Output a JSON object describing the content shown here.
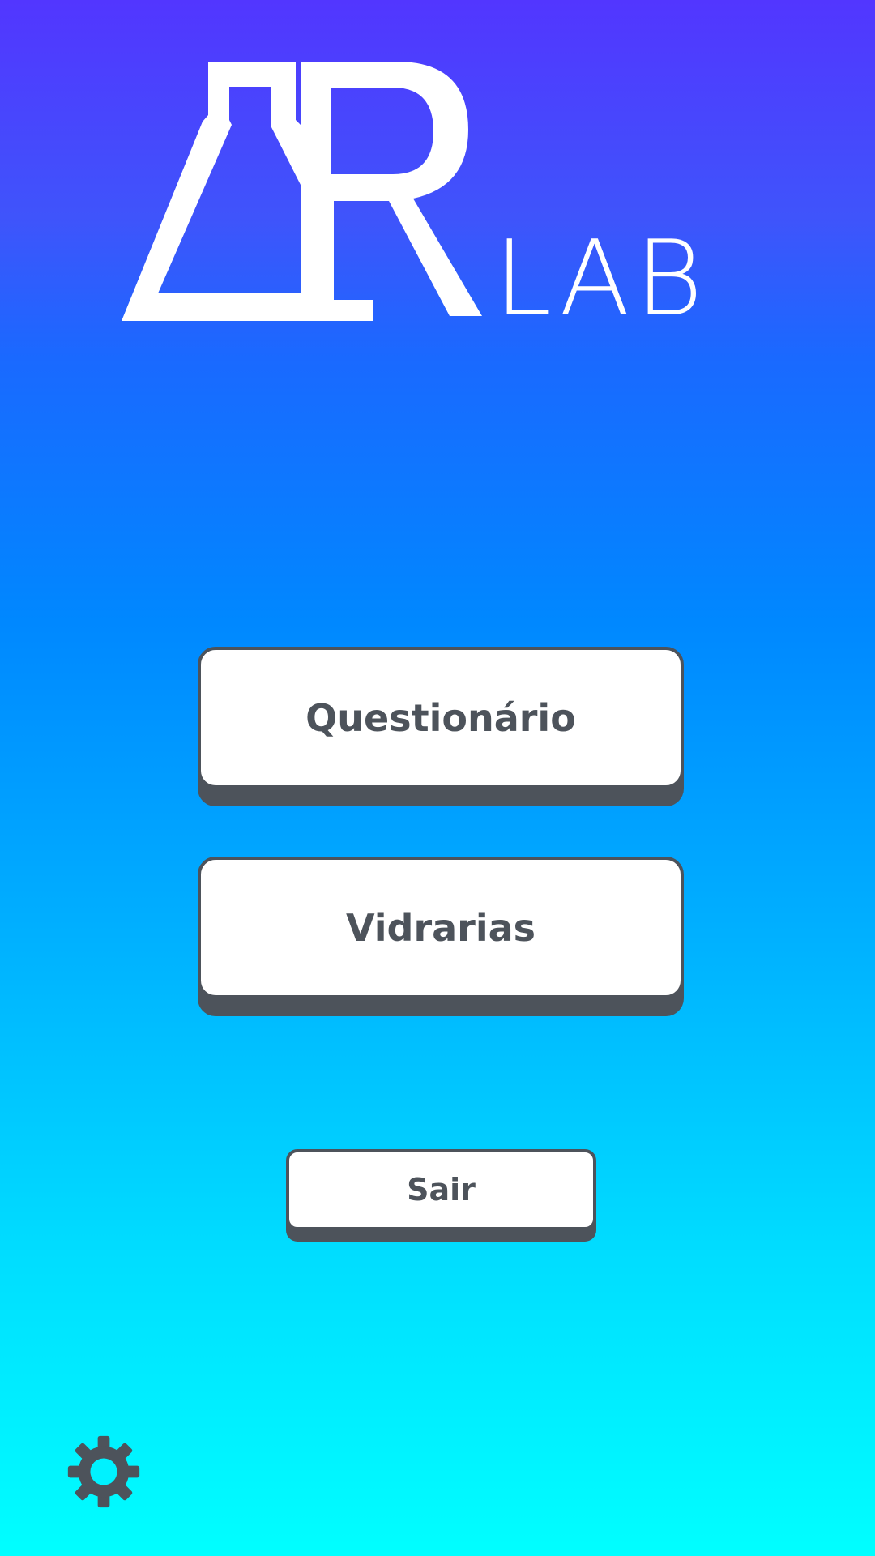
{
  "app": {
    "logo_suffix": "LAB"
  },
  "menu": {
    "questionario_label": "Questionário",
    "vidrarias_label": "Vidrarias",
    "sair_label": "Sair"
  },
  "icons": {
    "settings": "gear-icon"
  },
  "colors": {
    "gradient_top": "#5236ff",
    "gradient_bottom": "#00ffff",
    "button_border": "#4d535b",
    "button_text": "#4d535b",
    "button_fill": "#ffffff",
    "logo": "#ffffff"
  }
}
